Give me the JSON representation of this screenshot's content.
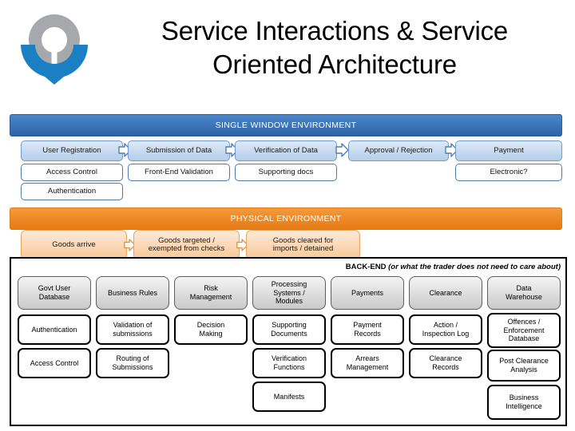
{
  "header": {
    "title_line1": "Service Interactions & Service",
    "title_line2": "Oriented Architecture",
    "logo_name": "organization-logo"
  },
  "single_window": {
    "banner": "SINGLE WINDOW ENVIRONMENT",
    "banner_color": "#3d77bb",
    "flow": [
      "User Registration",
      "Submission of Data",
      "Verification of Data",
      "Approval / Rejection",
      "Payment"
    ],
    "sub_row_1": [
      "Access Control",
      "Front-End Validation",
      "Supporting docs",
      "",
      "Electronic?"
    ],
    "sub_row_2": [
      "Authentication",
      "",
      "",
      "",
      ""
    ]
  },
  "physical": {
    "banner": "PHYSICAL ENVIRONMENT",
    "banner_color": "#ef8b28",
    "flow": [
      "Goods arrive",
      "Goods targeted / exempted from checks",
      "Goods cleared for imports / detained"
    ],
    "flow_lines": [
      [
        "Goods arrive"
      ],
      [
        "Goods targeted /",
        "exempted from checks"
      ],
      [
        "Goods cleared for",
        "imports / detained"
      ]
    ]
  },
  "backend": {
    "label_bold": "BACK-END",
    "label_italic": "(or what the trader does not need to care about)",
    "columns": [
      {
        "head": [
          "Govt  User",
          "Database"
        ],
        "items": [
          [
            "Authentication"
          ],
          [
            "Access Control"
          ]
        ]
      },
      {
        "head": [
          "Business Rules"
        ],
        "items": [
          [
            "Validation of",
            "submissions"
          ],
          [
            "Routing of",
            "Submissions"
          ]
        ]
      },
      {
        "head": [
          "Risk",
          "Management"
        ],
        "items": [
          [
            "Decision",
            "Making"
          ]
        ]
      },
      {
        "head": [
          "Processing",
          "Systems /",
          "Modules"
        ],
        "items": [
          [
            "Supporting",
            "Documents"
          ],
          [
            "Verification",
            "Functions"
          ],
          [
            "Manifests"
          ]
        ]
      },
      {
        "head": [
          "Payments"
        ],
        "items": [
          [
            "Payment",
            "Records"
          ],
          [
            "Arrears",
            "Management"
          ]
        ]
      },
      {
        "head": [
          "Clearance"
        ],
        "items": [
          [
            "Action /",
            "Inspection Log"
          ],
          [
            "Clearance",
            "Records"
          ]
        ]
      },
      {
        "head": [
          "Data",
          "Warehouse"
        ],
        "items": [
          [
            "Offences /",
            "Enforcement",
            "Database"
          ],
          [
            "Post Clearance",
            "Analysis"
          ],
          [
            "Business",
            "Intelligence"
          ]
        ]
      }
    ]
  }
}
